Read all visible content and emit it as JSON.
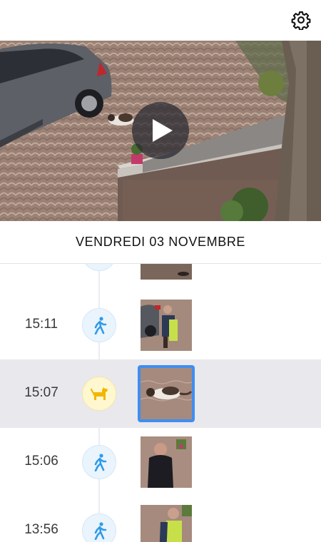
{
  "header": {
    "settings_icon": "gear-icon"
  },
  "player": {
    "play_icon": "play-icon"
  },
  "date_label": "VENDREDI 03 NOVEMBRE",
  "events": [
    {
      "time": "",
      "type": "person",
      "icon": "walking-person-icon"
    },
    {
      "time": "15:11",
      "type": "person",
      "icon": "walking-person-icon"
    },
    {
      "time": "15:07",
      "type": "animal",
      "icon": "dog-icon",
      "selected": true
    },
    {
      "time": "15:06",
      "type": "person",
      "icon": "walking-person-icon"
    },
    {
      "time": "13:56",
      "type": "person",
      "icon": "walking-person-icon"
    }
  ],
  "colors": {
    "person_icon": "#2f9be8",
    "animal_icon": "#f2b600",
    "selected_border": "#3e8ef0",
    "selected_row_bg": "#e8e8ed"
  }
}
